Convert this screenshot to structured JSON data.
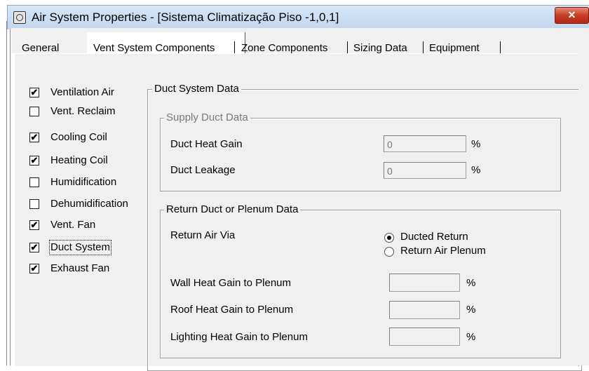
{
  "window": {
    "title": "Air System Properties - [Sistema Climatização Piso -1,0,1]",
    "close_label": "✕"
  },
  "tabs": [
    {
      "label": "General",
      "selected": false
    },
    {
      "label": "Vent System Components",
      "selected": true
    },
    {
      "label": "Zone Components",
      "selected": false
    },
    {
      "label": "Sizing Data",
      "selected": false
    },
    {
      "label": "Equipment",
      "selected": false
    }
  ],
  "components": [
    {
      "label": "Ventilation Air",
      "checked": true,
      "mark": "✔"
    },
    {
      "label": "Vent. Reclaim",
      "checked": false,
      "mark": ""
    },
    {
      "label": "Cooling Coil",
      "checked": true,
      "mark": "✔"
    },
    {
      "label": "Heating Coil",
      "checked": true,
      "mark": "✔"
    },
    {
      "label": "Humidification",
      "checked": false,
      "mark": ""
    },
    {
      "label": "Dehumidification",
      "checked": false,
      "mark": ""
    },
    {
      "label": "Vent. Fan",
      "checked": true,
      "mark": "✔"
    },
    {
      "label": "Duct System",
      "checked": true,
      "mark": "✔"
    },
    {
      "label": "Exhaust Fan",
      "checked": true,
      "mark": "✔"
    }
  ],
  "duct_system": {
    "title": "Duct System Data",
    "supply": {
      "title": "Supply Duct Data",
      "heat_gain": {
        "label": "Duct Heat Gain",
        "value": "0",
        "unit": "%"
      },
      "leakage": {
        "label": "Duct Leakage",
        "value": "0",
        "unit": "%"
      }
    },
    "return": {
      "title": "Return Duct or Plenum Data",
      "via_label": "Return Air Via",
      "options": [
        {
          "label": "Ducted Return",
          "selected": true
        },
        {
          "label": "Return Air Plenum",
          "selected": false
        }
      ],
      "wall": {
        "label": "Wall Heat Gain to Plenum",
        "value": "",
        "unit": "%"
      },
      "roof": {
        "label": "Roof Heat Gain to Plenum",
        "value": "",
        "unit": "%"
      },
      "lighting": {
        "label": "Lighting Heat Gain to Plenum",
        "value": "",
        "unit": "%"
      }
    }
  }
}
